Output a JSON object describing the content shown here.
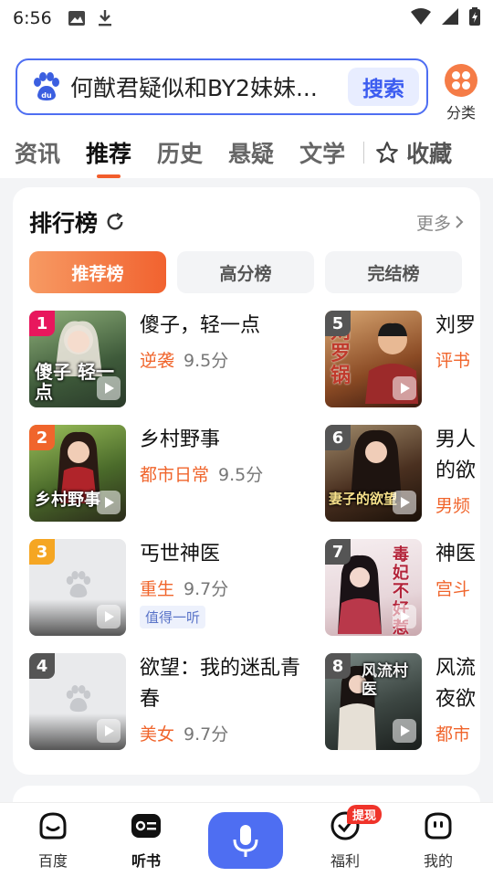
{
  "status": {
    "time": "6:56"
  },
  "search": {
    "query": "何猷君疑似和BY2妹妹...",
    "button_label": "搜索"
  },
  "category": {
    "label": "分类"
  },
  "tabs": [
    {
      "label": "资讯"
    },
    {
      "label": "推荐"
    },
    {
      "label": "历史"
    },
    {
      "label": "悬疑"
    },
    {
      "label": "文学"
    }
  ],
  "favorite": {
    "label": "收藏"
  },
  "ranking": {
    "title": "排行榜",
    "more": "更多",
    "segments": [
      "推荐榜",
      "高分榜",
      "完结榜"
    ],
    "left": [
      {
        "rank": "1",
        "title": "傻子，轻一点",
        "genre": "逆袭",
        "score": "9.5分",
        "cover_text": "傻子 轻一点"
      },
      {
        "rank": "2",
        "title": "乡村野事",
        "genre": "都市日常",
        "score": "9.5分",
        "cover_text": "乡村野事"
      },
      {
        "rank": "3",
        "title": "丐世神医",
        "genre": "重生",
        "score": "9.7分",
        "tag": "值得一听"
      },
      {
        "rank": "4",
        "title": "欲望：我的迷乱青春",
        "genre": "美女",
        "score": "9.7分"
      }
    ],
    "right": [
      {
        "rank": "5",
        "title": "刘罗",
        "genre": "评书",
        "cover_text": "刘罗锅"
      },
      {
        "rank": "6",
        "title": "男人的欲",
        "genre": "男频",
        "cover_text": "妻子的欲望"
      },
      {
        "rank": "7",
        "title": "神医",
        "genre": "宫斗",
        "cover_text": "毒妃不好惹"
      },
      {
        "rank": "8",
        "title": "风流夜欲",
        "genre": "都市",
        "cover_text": "风流村医"
      }
    ]
  },
  "bottom_nav": [
    {
      "label": "百度"
    },
    {
      "label": "听书"
    },
    {
      "label": "福利",
      "badge": "提现"
    },
    {
      "label": "我的"
    }
  ]
}
